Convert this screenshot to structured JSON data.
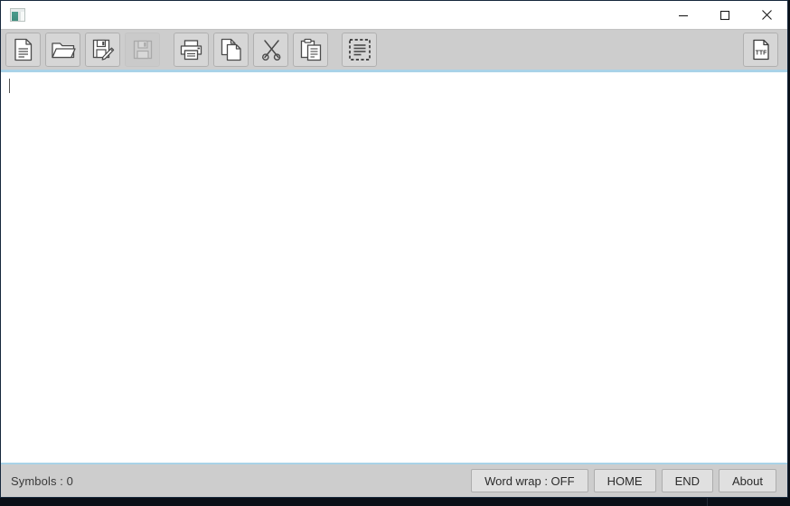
{
  "window": {
    "title": "",
    "app_icon": "app-window-icon",
    "controls": {
      "minimize_label": "—",
      "maximize_label": "☐",
      "close_label": "✕"
    }
  },
  "toolbar": {
    "buttons": [
      {
        "name": "new-file-button",
        "icon": "new-document-icon",
        "tooltip": "New",
        "disabled": false
      },
      {
        "name": "open-file-button",
        "icon": "open-folder-icon",
        "tooltip": "Open",
        "disabled": false
      },
      {
        "name": "save-as-button",
        "icon": "save-as-icon",
        "tooltip": "Save as",
        "disabled": false
      },
      {
        "name": "save-button",
        "icon": "save-icon",
        "tooltip": "Save",
        "disabled": true
      },
      {
        "name": "print-button",
        "icon": "printer-icon",
        "tooltip": "Print",
        "disabled": false
      },
      {
        "name": "copy-button",
        "icon": "copy-icon",
        "tooltip": "Copy",
        "disabled": false
      },
      {
        "name": "cut-button",
        "icon": "scissors-icon",
        "tooltip": "Cut",
        "disabled": false
      },
      {
        "name": "paste-button",
        "icon": "clipboard-icon",
        "tooltip": "Paste",
        "disabled": false
      },
      {
        "name": "select-all-button",
        "icon": "select-all-icon",
        "tooltip": "Select all",
        "disabled": false
      }
    ],
    "font_button": {
      "name": "font-button",
      "icon": "ttf-font-icon",
      "label": "TTF"
    }
  },
  "editor": {
    "content": "",
    "caret_visible": true
  },
  "statusbar": {
    "symbols_label": "Symbols : 0",
    "buttons": [
      {
        "name": "word-wrap-button",
        "label": "Word wrap : OFF"
      },
      {
        "name": "home-button",
        "label": "HOME"
      },
      {
        "name": "end-button",
        "label": "END"
      },
      {
        "name": "about-button",
        "label": "About"
      }
    ]
  },
  "colors": {
    "window_border": "#16283c",
    "accent_edge": "#a9d3e8",
    "toolbar_bg": "#cdcdcd",
    "button_bg": "#d6d6d6",
    "editor_bg": "#ffffff",
    "desktop_bg": "#0b1018"
  }
}
